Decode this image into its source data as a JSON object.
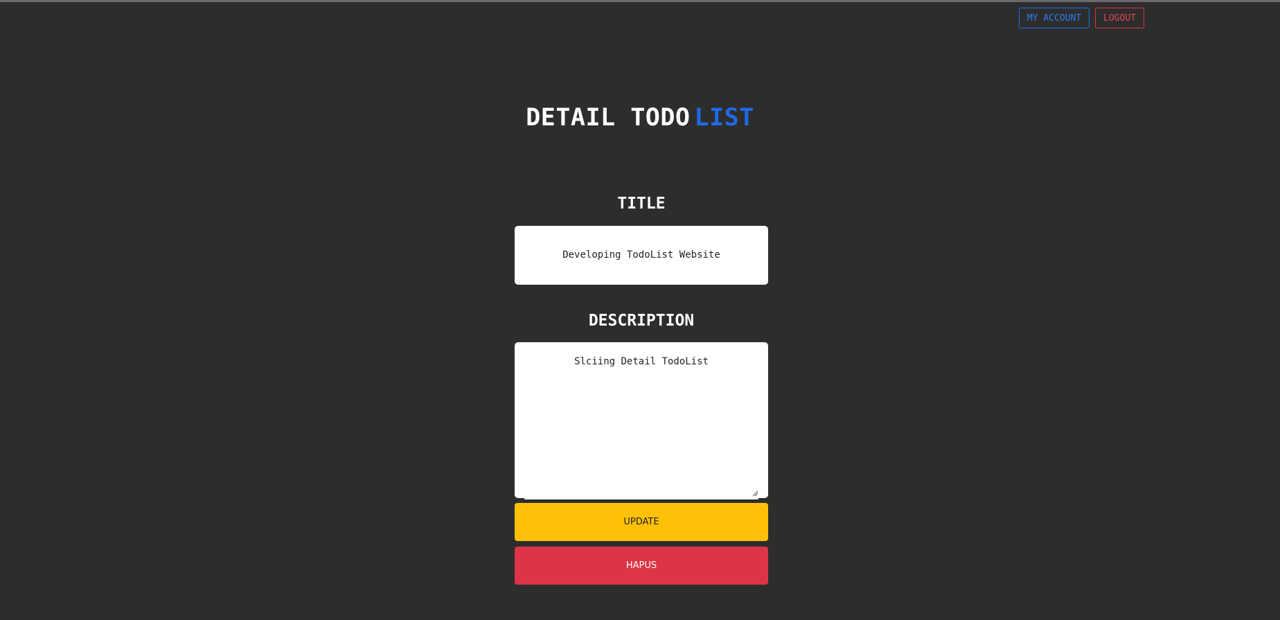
{
  "nav": {
    "account_label": "MY ACCOUNT",
    "logout_label": "LOGOUT"
  },
  "page": {
    "heading_main": "DETAIL TODO",
    "heading_accent": "LIST"
  },
  "form": {
    "title_label": "TITLE",
    "title_value": "Developing TodoList Website",
    "description_label": "DESCRIPTION",
    "description_value": "Slciing Detail TodoList",
    "update_label": "UPDATE",
    "delete_label": "HAPUS"
  },
  "colors": {
    "background": "#2d2d2d",
    "accent_blue": "#2069e6",
    "update_yellow": "#ffc107",
    "delete_red": "#dc3545"
  }
}
